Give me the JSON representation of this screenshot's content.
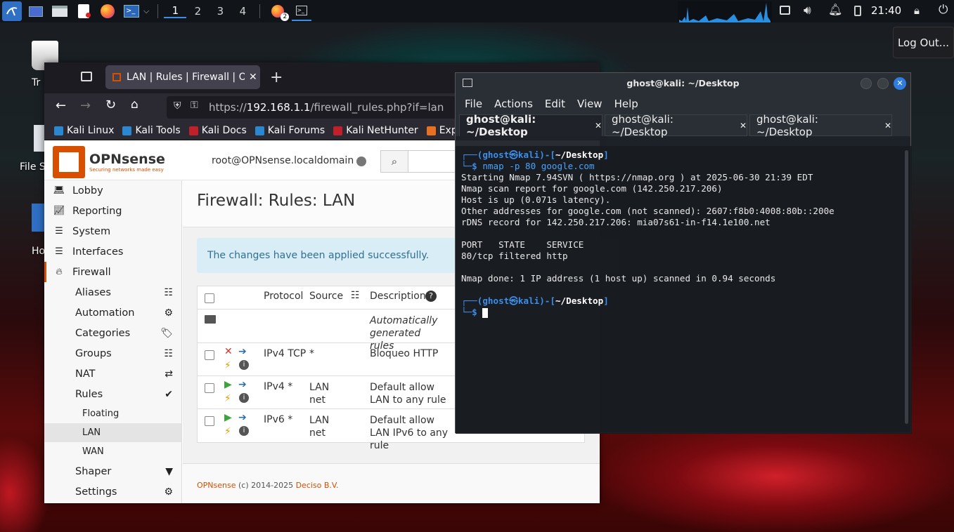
{
  "panel": {
    "workspaces": [
      "1",
      "2",
      "3",
      "4"
    ],
    "badge": "2",
    "clock": "21:40"
  },
  "logout_label": "Log Out...",
  "desktop": {
    "trash_label": "Tr",
    "files_label": "File S",
    "home_label": "Ho"
  },
  "browser": {
    "tab_title": "LAN | Rules | Firewall | OP",
    "url_prefix": "https://",
    "url_host": "192.168.1.1",
    "url_path": "/firewall_rules.php?if=lan",
    "bookmarks": [
      {
        "label": "Kali Linux",
        "color": "#2a87d0"
      },
      {
        "label": "Kali Tools",
        "color": "#2a87d0"
      },
      {
        "label": "Kali Docs",
        "color": "#c0202a"
      },
      {
        "label": "Kali Forums",
        "color": "#2a87d0"
      },
      {
        "label": "Kali NetHunter",
        "color": "#c0202a"
      },
      {
        "label": "Explo",
        "color": "#e87020"
      }
    ]
  },
  "opnsense": {
    "logo": "OPNsense",
    "tagline": "Securing networks made easy",
    "user": "root@OPNsense.localdomain",
    "title": "Firewall: Rules: LAN",
    "alert": "The changes have been applied successfully.",
    "sidebar": {
      "lobby": "Lobby",
      "reporting": "Reporting",
      "system": "System",
      "interfaces": "Interfaces",
      "firewall": "Firewall",
      "aliases": "Aliases",
      "automation": "Automation",
      "categories": "Categories",
      "groups": "Groups",
      "nat": "NAT",
      "rules": "Rules",
      "floating": "Floating",
      "lan": "LAN",
      "wan": "WAN",
      "shaper": "Shaper",
      "settings": "Settings"
    },
    "table": {
      "headers": {
        "protocol": "Protocol",
        "source": "Source",
        "description": "Description"
      },
      "auto_desc": "Automatically generated rules",
      "rows": [
        {
          "protocol": "IPv4 TCP",
          "source": "*",
          "description": "Bloqueo HTTP"
        },
        {
          "protocol": "IPv4 *",
          "source": "LAN net",
          "description": "Default allow LAN to any rule"
        },
        {
          "protocol": "IPv6 *",
          "source": "LAN net",
          "description": "Default allow LAN IPv6 to any rule"
        }
      ]
    },
    "footer_brand": "OPNsense",
    "footer_text": " (c) 2014-2025 ",
    "footer_company": "Deciso B.V."
  },
  "terminal": {
    "title": "ghost@kali: ~/Desktop",
    "menu": [
      "File",
      "Actions",
      "Edit",
      "View",
      "Help"
    ],
    "tabs": [
      "ghost@kali: ~/Desktop",
      "ghost@kali: ~/Desktop",
      "ghost@kali: ~/Desktop"
    ],
    "prompt_user": "ghost",
    "prompt_host": "kali",
    "prompt_dir": "~/Desktop",
    "command": "nmap -p 80 google.com",
    "output": [
      "Starting Nmap 7.94SVN ( https://nmap.org ) at 2025-06-30 21:39 EDT",
      "Nmap scan report for google.com (142.250.217.206)",
      "Host is up (0.071s latency).",
      "Other addresses for google.com (not scanned): 2607:f8b0:4008:80b::200e",
      "rDNS record for 142.250.217.206: mia07s61-in-f14.1e100.net",
      "",
      "PORT   STATE    SERVICE",
      "80/tcp filtered http",
      "",
      "Nmap done: 1 IP address (1 host up) scanned in 0.94 seconds"
    ]
  },
  "colors": {
    "accent": "#3a8ee6",
    "opnsense_orange": "#d94f00",
    "kali_blue": "#3b8eea"
  }
}
